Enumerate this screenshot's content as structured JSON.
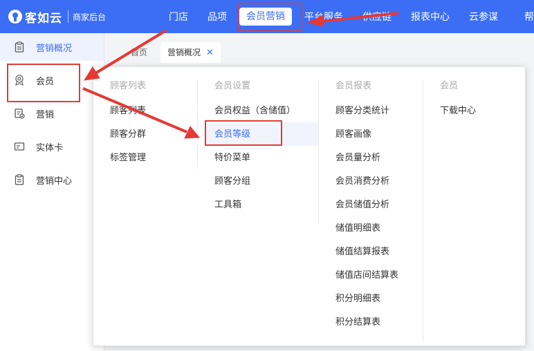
{
  "brand": {
    "name": "客如云",
    "subtitle": "商家后台"
  },
  "topnav": {
    "items": [
      {
        "label": "门店",
        "active": false
      },
      {
        "label": "品项",
        "active": false
      },
      {
        "label": "会员营销",
        "active": true
      },
      {
        "label": "平台服务",
        "active": false
      },
      {
        "label": "供应链",
        "active": false
      },
      {
        "label": "报表中心",
        "active": false
      },
      {
        "label": "云参谋",
        "active": false
      },
      {
        "label": "帮",
        "active": false
      }
    ]
  },
  "sidebar": {
    "items": [
      {
        "label": "营销概况",
        "icon": "clipboard-icon",
        "active": true
      },
      {
        "label": "会员",
        "icon": "member-badge-icon",
        "active": false
      },
      {
        "label": "营销",
        "icon": "marketing-doc-icon",
        "active": false
      },
      {
        "label": "实体卡",
        "icon": "card-icon",
        "active": false
      },
      {
        "label": "营销中心",
        "icon": "clipboard-icon",
        "active": false
      }
    ]
  },
  "tabs": {
    "items": [
      {
        "label": "首页",
        "active": false
      },
      {
        "label": "营销概况",
        "active": true,
        "close": "✕"
      }
    ]
  },
  "menu": {
    "columns": [
      {
        "title": "顾客列表",
        "items": [
          "顾客列表",
          "顾客分群",
          "标签管理"
        ]
      },
      {
        "title": "会员设置",
        "items": [
          "会员权益（含储值）",
          "会员等级",
          "特价菜单",
          "顾客分组",
          "工具箱"
        ],
        "selected": "会员等级"
      },
      {
        "title": "会员报表",
        "items": [
          "顾客分类统计",
          "顾客画像",
          "会员量分析",
          "会员消费分析",
          "会员储值分析",
          "储值明细表",
          "储值结算报表",
          "储值店间结算表",
          "积分明细表",
          "积分结算表"
        ]
      },
      {
        "title": "会员",
        "items": [
          "下载中心"
        ]
      }
    ]
  },
  "colors": {
    "primary": "#3b6ef5",
    "annotation": "#e53935"
  }
}
